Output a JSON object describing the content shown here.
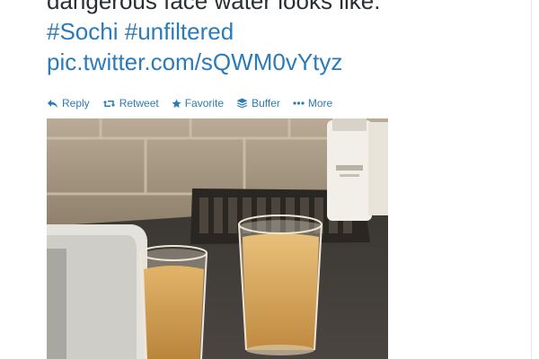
{
  "tweet": {
    "text_line1": "dangerous face water looks like.",
    "hashtags": [
      "#Sochi",
      "#unfiltered"
    ],
    "pic_link": "pic.twitter.com/sQWM0vYtyz"
  },
  "actions": [
    {
      "label": "Reply",
      "icon": "reply-icon"
    },
    {
      "label": "Retweet",
      "icon": "retweet-icon"
    },
    {
      "label": "Favorite",
      "icon": "star-icon"
    },
    {
      "label": "Buffer",
      "icon": "buffer-icon"
    },
    {
      "label": "More",
      "icon": "more-dots-icon"
    }
  ],
  "colors": {
    "link": "#2b7bb9",
    "text": "#292f33",
    "water": "#d9a45a"
  }
}
